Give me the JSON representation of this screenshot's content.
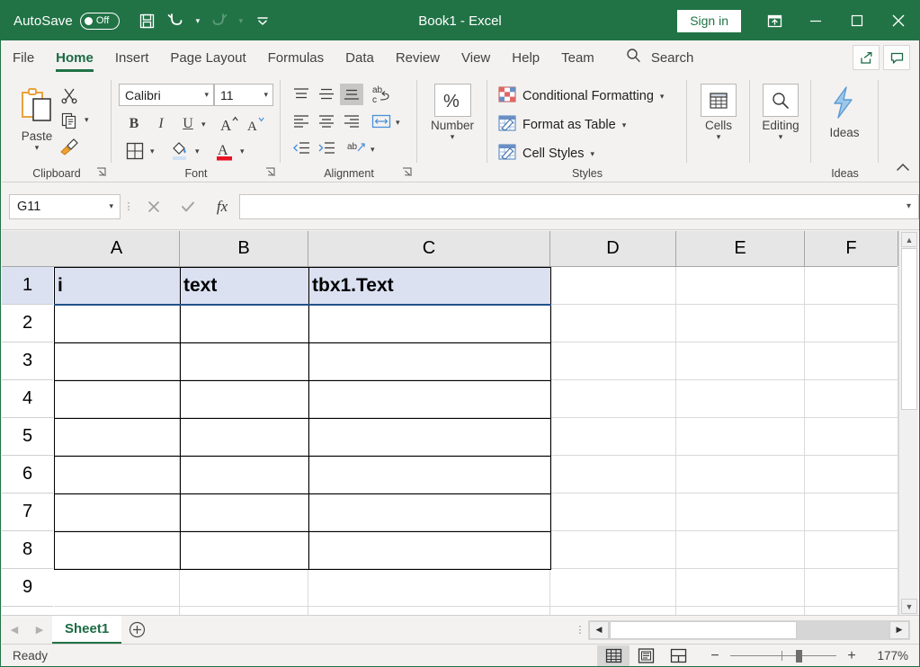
{
  "titlebar": {
    "autosave_label": "AutoSave",
    "autosave_state": "Off",
    "save_icon": "save-icon",
    "undo_icon": "undo-icon",
    "redo_icon": "redo-icon",
    "customize_icon": "customize-quick-access-toolbar-icon",
    "window_title": "Book1  -  Excel",
    "sign_in_label": "Sign in",
    "ribbon_display_icon": "ribbon-display-options-icon",
    "minimize_icon": "minimize-icon",
    "maximize_icon": "maximize-icon",
    "close_icon": "close-icon",
    "brand_color": "#217346"
  },
  "tabs": [
    {
      "label": "File",
      "active": false
    },
    {
      "label": "Home",
      "active": true
    },
    {
      "label": "Insert",
      "active": false
    },
    {
      "label": "Page Layout",
      "active": false
    },
    {
      "label": "Formulas",
      "active": false
    },
    {
      "label": "Data",
      "active": false
    },
    {
      "label": "Review",
      "active": false
    },
    {
      "label": "View",
      "active": false
    },
    {
      "label": "Help",
      "active": false
    },
    {
      "label": "Team",
      "active": false
    }
  ],
  "search": {
    "label": "Search",
    "icon": "search-icon"
  },
  "tab_right": {
    "share_icon": "share-icon",
    "comments_icon": "comments-icon"
  },
  "ribbon": {
    "clipboard": {
      "group_label": "Clipboard",
      "paste_label": "Paste",
      "paste_icon": "paste-icon",
      "cut_icon": "cut-scissors-icon",
      "copy_icon": "copy-icon",
      "format_painter_icon": "format-painter-icon",
      "dialog_launcher_icon": "dialog-launcher-icon"
    },
    "font": {
      "group_label": "Font",
      "font_name": "Calibri",
      "font_size": "11",
      "bold_label": "B",
      "italic_label": "I",
      "underline_label": "U",
      "grow_font_label": "A",
      "shrink_font_label": "A",
      "borders_icon": "borders-icon",
      "fill_color_icon": "fill-color-icon",
      "font_color_icon": "font-color-icon",
      "font_color_swatch": "#e81123",
      "dialog_launcher_icon": "dialog-launcher-icon"
    },
    "alignment": {
      "group_label": "Alignment",
      "align_top_icon": "align-top-icon",
      "align_middle_icon": "align-middle-icon",
      "align_bottom_icon": "align-bottom-icon",
      "wrap_text_icon": "wrap-text-icon",
      "align_left_icon": "align-left-icon",
      "align_center_icon": "align-center-icon",
      "align_right_icon": "align-right-icon",
      "merge_center_icon": "merge-and-center-icon",
      "decrease_indent_icon": "decrease-indent-icon",
      "increase_indent_icon": "increase-indent-icon",
      "orientation_icon": "text-orientation-icon",
      "dialog_launcher_icon": "dialog-launcher-icon"
    },
    "number": {
      "group_label": "",
      "button_label": "Number",
      "icon": "percent-icon",
      "caret": "chevron-down-icon"
    },
    "styles": {
      "group_label": "Styles",
      "items": [
        {
          "label": "Conditional Formatting",
          "icon": "conditional-formatting-icon"
        },
        {
          "label": "Format as Table",
          "icon": "format-as-table-icon"
        },
        {
          "label": "Cell Styles",
          "icon": "cell-styles-icon"
        }
      ]
    },
    "cells": {
      "label": "Cells",
      "icon": "cells-insert-icon"
    },
    "editing": {
      "label": "Editing",
      "icon": "editing-find-icon"
    },
    "ideas": {
      "group_label": "Ideas",
      "label": "Ideas",
      "icon": "ideas-lightning-icon"
    },
    "collapse_icon": "collapse-ribbon-icon"
  },
  "formula_bar": {
    "name_box_value": "G11",
    "name_box_caret": "chevron-down-icon",
    "cancel_icon": "cancel-x-icon",
    "enter_icon": "enter-check-icon",
    "insert_function_icon": "insert-function-fx-icon",
    "formula_value": "",
    "expand_caret": "chevron-down-icon"
  },
  "grid": {
    "select_all_icon": "select-all-corner-icon",
    "columns": [
      "A",
      "B",
      "C",
      "D",
      "E",
      "F"
    ],
    "rows": [
      "1",
      "2",
      "3",
      "4",
      "5",
      "6",
      "7",
      "8",
      "9"
    ],
    "cells": {
      "A1": "i",
      "B1": "text",
      "C1": "tbx1.Text"
    },
    "selection_range": "A1:C1",
    "selection_fill": "#dce1f2",
    "bordered_range": "A1:C8",
    "scroll_up_icon": "scroll-up-arrow-icon",
    "scroll_down_icon": "scroll-down-arrow-icon"
  },
  "sheet_bar": {
    "prev_icon": "previous-sheet-icon",
    "next_icon": "next-sheet-icon",
    "sheets": [
      {
        "name": "Sheet1",
        "active": true
      }
    ],
    "add_sheet_icon": "add-sheet-plus-icon",
    "scroll_left_icon": "scroll-left-arrow-icon",
    "scroll_right_icon": "scroll-right-arrow-icon"
  },
  "status_bar": {
    "status_text": "Ready",
    "views": [
      {
        "name": "normal-view",
        "icon": "normal-view-icon",
        "selected": true
      },
      {
        "name": "page-layout-view",
        "icon": "page-layout-view-icon",
        "selected": false
      },
      {
        "name": "page-break-preview",
        "icon": "page-break-preview-icon",
        "selected": false
      }
    ],
    "zoom_out_label": "−",
    "zoom_in_label": "+",
    "zoom_level": "177%"
  }
}
